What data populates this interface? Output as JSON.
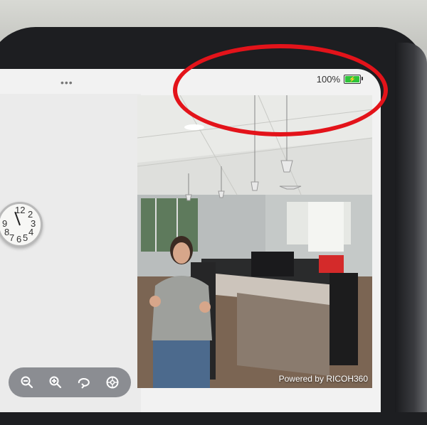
{
  "status_bar": {
    "more_dots": "•••",
    "battery_percent": "100%",
    "battery_level": 1.0,
    "charging": true,
    "battery_color": "#2ec43a"
  },
  "clock": {
    "numbers": [
      "12",
      "9",
      "8",
      "7",
      "6",
      "5",
      "4",
      "3",
      "2"
    ]
  },
  "toolbar": {
    "tools": [
      {
        "icon": "zoom-out-icon"
      },
      {
        "icon": "zoom-in-icon"
      },
      {
        "icon": "rotate-icon"
      },
      {
        "icon": "settings-icon"
      }
    ]
  },
  "viewer": {
    "watermark": "Powered by RICOH360"
  },
  "annotation": {
    "color": "#e3131a",
    "shape": "ellipse"
  }
}
